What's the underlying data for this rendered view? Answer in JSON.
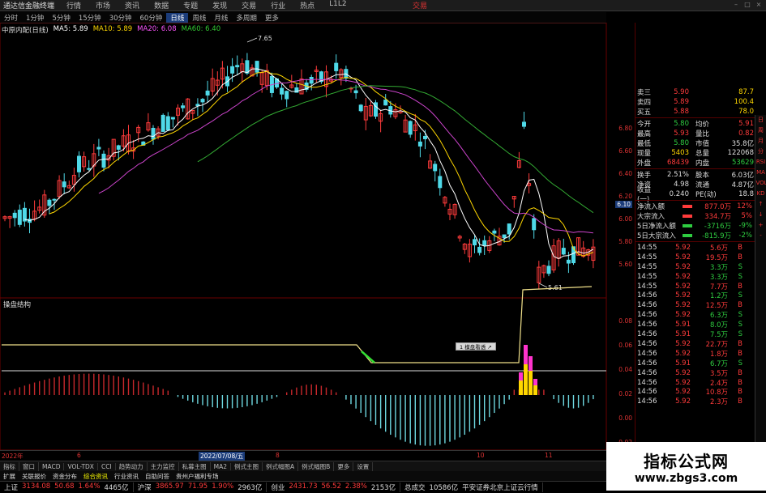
{
  "window": {
    "title": "通达信金融终端",
    "menu": [
      "行情",
      "市场",
      "资讯",
      "数据",
      "专题",
      "发现",
      "交易",
      "行业",
      "热点",
      "L1L2"
    ],
    "brand": "交易"
  },
  "periods": [
    "分时",
    "1分钟",
    "5分钟",
    "15分钟",
    "30分钟",
    "60分钟",
    "日线",
    "周线",
    "月线",
    "多周期",
    "更多"
  ],
  "active_period": "日线",
  "stock": {
    "name": "中原内配(日线)"
  },
  "ma_legend": [
    {
      "label": "MA5: 5.89",
      "color": "#ffffff"
    },
    {
      "label": "MA10: 5.89",
      "color": "#ffd700"
    },
    {
      "label": "MA20: 6.08",
      "color": "#ff55ff"
    },
    {
      "label": "MA60: 6.40",
      "color": "#33cc33"
    }
  ],
  "price_annotations": {
    "high": "7.65",
    "low": "5.61",
    "current_tag": "6.10"
  },
  "price_axis": [
    "6.80",
    "6.60",
    "6.40",
    "6.20",
    "6.00",
    "5.80",
    "5.60"
  ],
  "indicator": {
    "title": "操盘结构",
    "tag": "1 模盘看透 ↗"
  },
  "indicator_axis": [
    "0.08",
    "0.06",
    "0.04",
    "0.02",
    "0.00",
    "-0.02"
  ],
  "date_axis": [
    {
      "label": "2022年",
      "hl": false
    },
    {
      "label": "6",
      "hl": false
    },
    {
      "label": "2022/07/08/五",
      "hl": true
    },
    {
      "label": "8",
      "hl": false
    },
    {
      "label": "10",
      "hl": false
    },
    {
      "label": "11",
      "hl": false
    }
  ],
  "bottom_tabs": [
    "指标",
    "窗口",
    "MACD",
    "VOL-TDX",
    "CCI",
    "趋势动力",
    "主力监控",
    "私募主图",
    "MA2",
    "例式主图",
    "例式幅图A",
    "例式幅图B",
    "更多",
    "设置"
  ],
  "bottom_tabs_right": "模板",
  "sub_tabs": [
    {
      "label": "扩展",
      "on": false
    },
    {
      "label": "关联报价",
      "on": false
    },
    {
      "label": "资金分布",
      "on": false
    },
    {
      "label": "综合资讯",
      "on": true
    },
    {
      "label": "行业资讯",
      "on": false
    },
    {
      "label": "自助问答",
      "on": false
    },
    {
      "label": "贵州户福利专场",
      "on": false
    }
  ],
  "quotes": {
    "asks": [
      {
        "label": "卖三",
        "price": "5.90",
        "vol": "87.7"
      },
      {
        "label": "卖四",
        "price": "5.89",
        "vol": "100.4"
      },
      {
        "label": "买五",
        "price": "5.88",
        "vol": "78.0"
      }
    ],
    "stats": [
      {
        "l1": "今开",
        "v1": "5.80",
        "c1": "green",
        "l2": "均价",
        "v2": "5.91",
        "c2": "red"
      },
      {
        "l1": "最高",
        "v1": "5.93",
        "c1": "red",
        "l2": "量比",
        "v2": "0.82",
        "c2": "red"
      },
      {
        "l1": "最低",
        "v1": "5.80",
        "c1": "green",
        "l2": "市值",
        "v2": "35.8亿",
        "c2": "white"
      },
      {
        "l1": "现量",
        "v1": "5403",
        "c1": "yellow",
        "l2": "总量",
        "v2": "122068",
        "c2": "white"
      },
      {
        "l1": "外盘",
        "v1": "68439",
        "c1": "red",
        "l2": "内盘",
        "v2": "53629",
        "c2": "green"
      },
      {
        "l1": "换手",
        "v1": "2.51%",
        "c1": "white",
        "l2": "股本",
        "v2": "6.03亿",
        "c2": "white"
      },
      {
        "l1": "净资",
        "v1": "4.98",
        "c1": "white",
        "l2": "流通",
        "v2": "4.87亿",
        "c2": "white"
      },
      {
        "l1": "收益(一)",
        "v1": "0.240",
        "c1": "white",
        "l2": "PE(动)",
        "v2": "18.8",
        "c2": "white"
      }
    ],
    "flows": [
      {
        "label": "净流入额",
        "val": "877.0万",
        "c": "red",
        "pct": "12%"
      },
      {
        "label": "大宗流入",
        "val": "334.7万",
        "c": "red",
        "pct": "5%"
      },
      {
        "label": "5日净流入额",
        "val": "-3716万",
        "c": "green",
        "pct": "-9%"
      },
      {
        "label": "5日大宗流入",
        "val": "-815.9万",
        "c": "green",
        "pct": "-2%"
      }
    ]
  },
  "ticks": [
    {
      "t": "14:55",
      "p": "5.92",
      "v": "5.6万",
      "bs": "B"
    },
    {
      "t": "14:55",
      "p": "5.92",
      "v": "19.5万",
      "bs": "B"
    },
    {
      "t": "14:55",
      "p": "5.92",
      "v": "3.3万",
      "bs": "S"
    },
    {
      "t": "14:55",
      "p": "5.92",
      "v": "3.3万",
      "bs": "S"
    },
    {
      "t": "14:55",
      "p": "5.92",
      "v": "7.7万",
      "bs": "B"
    },
    {
      "t": "14:56",
      "p": "5.92",
      "v": "1.2万",
      "bs": "S"
    },
    {
      "t": "14:56",
      "p": "5.92",
      "v": "12.5万",
      "bs": "B"
    },
    {
      "t": "14:56",
      "p": "5.92",
      "v": "6.3万",
      "bs": "S"
    },
    {
      "t": "14:56",
      "p": "5.91",
      "v": "8.0万",
      "bs": "S"
    },
    {
      "t": "14:56",
      "p": "5.91",
      "v": "7.5万",
      "bs": "S"
    },
    {
      "t": "14:56",
      "p": "5.92",
      "v": "22.7万",
      "bs": "B"
    },
    {
      "t": "14:56",
      "p": "5.92",
      "v": "1.8万",
      "bs": "B"
    },
    {
      "t": "14:56",
      "p": "5.91",
      "v": "6.7万",
      "bs": "S"
    },
    {
      "t": "14:56",
      "p": "5.92",
      "v": "3.5万",
      "bs": "B"
    },
    {
      "t": "14:56",
      "p": "5.92",
      "v": "2.4万",
      "bs": "B"
    },
    {
      "t": "14:56",
      "p": "5.92",
      "v": "10.8万",
      "bs": "B"
    },
    {
      "t": "14:56",
      "p": "5.92",
      "v": "2.3万",
      "bs": "B"
    }
  ],
  "status": {
    "groups": [
      {
        "name": "上证",
        "vals": [
          {
            "v": "3134.08",
            "c": "red"
          },
          {
            "v": "50.68",
            "c": "red"
          },
          {
            "v": "1.64%",
            "c": "red"
          },
          {
            "v": "4465亿",
            "c": "white"
          }
        ]
      },
      {
        "name": "沪深",
        "vals": [
          {
            "v": "3865.97",
            "c": "red"
          },
          {
            "v": "71.95",
            "c": "red"
          },
          {
            "v": "1.90%",
            "c": "red"
          },
          {
            "v": "2963亿",
            "c": "white"
          }
        ]
      },
      {
        "name": "创业",
        "vals": [
          {
            "v": "2431.73",
            "c": "red"
          },
          {
            "v": "56.52",
            "c": "red"
          },
          {
            "v": "2.38%",
            "c": "red"
          },
          {
            "v": "2153亿",
            "c": "white"
          }
        ]
      },
      {
        "name": "总成交",
        "vals": [
          {
            "v": "10586亿",
            "c": "white"
          },
          {
            "v": "平安证券北京上证云行情",
            "c": "white"
          }
        ]
      }
    ]
  },
  "side_tools": [
    "日",
    "周",
    "月",
    "分",
    "RSI",
    "MA",
    "VOL",
    "KD",
    "↑",
    "↓",
    "+",
    "-"
  ],
  "watermark": {
    "line1": "指标公式网",
    "line2": "www.zbgs3.com"
  },
  "colors": {
    "up": "#ff3b3b",
    "down": "#4fd9e8",
    "ma5": "#ffffff",
    "ma10": "#ffd700",
    "ma20": "#cc44cc",
    "ma60": "#33aa33"
  }
}
